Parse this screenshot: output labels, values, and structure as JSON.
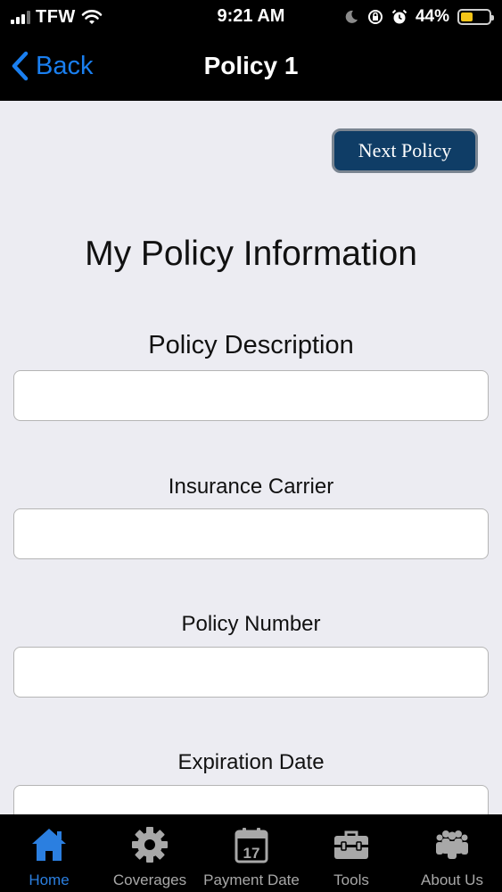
{
  "status_bar": {
    "carrier": "TFW",
    "time": "9:21 AM",
    "battery": "44%",
    "battery_level": 0.44
  },
  "nav": {
    "back_label": "Back",
    "title": "Policy 1"
  },
  "content": {
    "next_button": "Next Policy",
    "heading": "My Policy Information",
    "fields": [
      {
        "label": "Policy Description",
        "value": ""
      },
      {
        "label": "Insurance Carrier",
        "value": ""
      },
      {
        "label": "Policy Number",
        "value": ""
      },
      {
        "label": "Expiration Date",
        "value": ""
      }
    ]
  },
  "tabs": [
    {
      "label": "Home",
      "icon": "home-icon",
      "active": true
    },
    {
      "label": "Coverages",
      "icon": "gear-icon",
      "active": false
    },
    {
      "label": "Payment Date",
      "icon": "calendar-icon",
      "calendar_day": "17",
      "active": false
    },
    {
      "label": "Tools",
      "icon": "toolbox-icon",
      "active": false
    },
    {
      "label": "About Us",
      "icon": "people-icon",
      "active": false
    }
  ],
  "colors": {
    "accent": "#1a7ff0",
    "button_bg": "#0f3d66",
    "battery": "#f5c518",
    "content_bg": "#ececf2"
  }
}
